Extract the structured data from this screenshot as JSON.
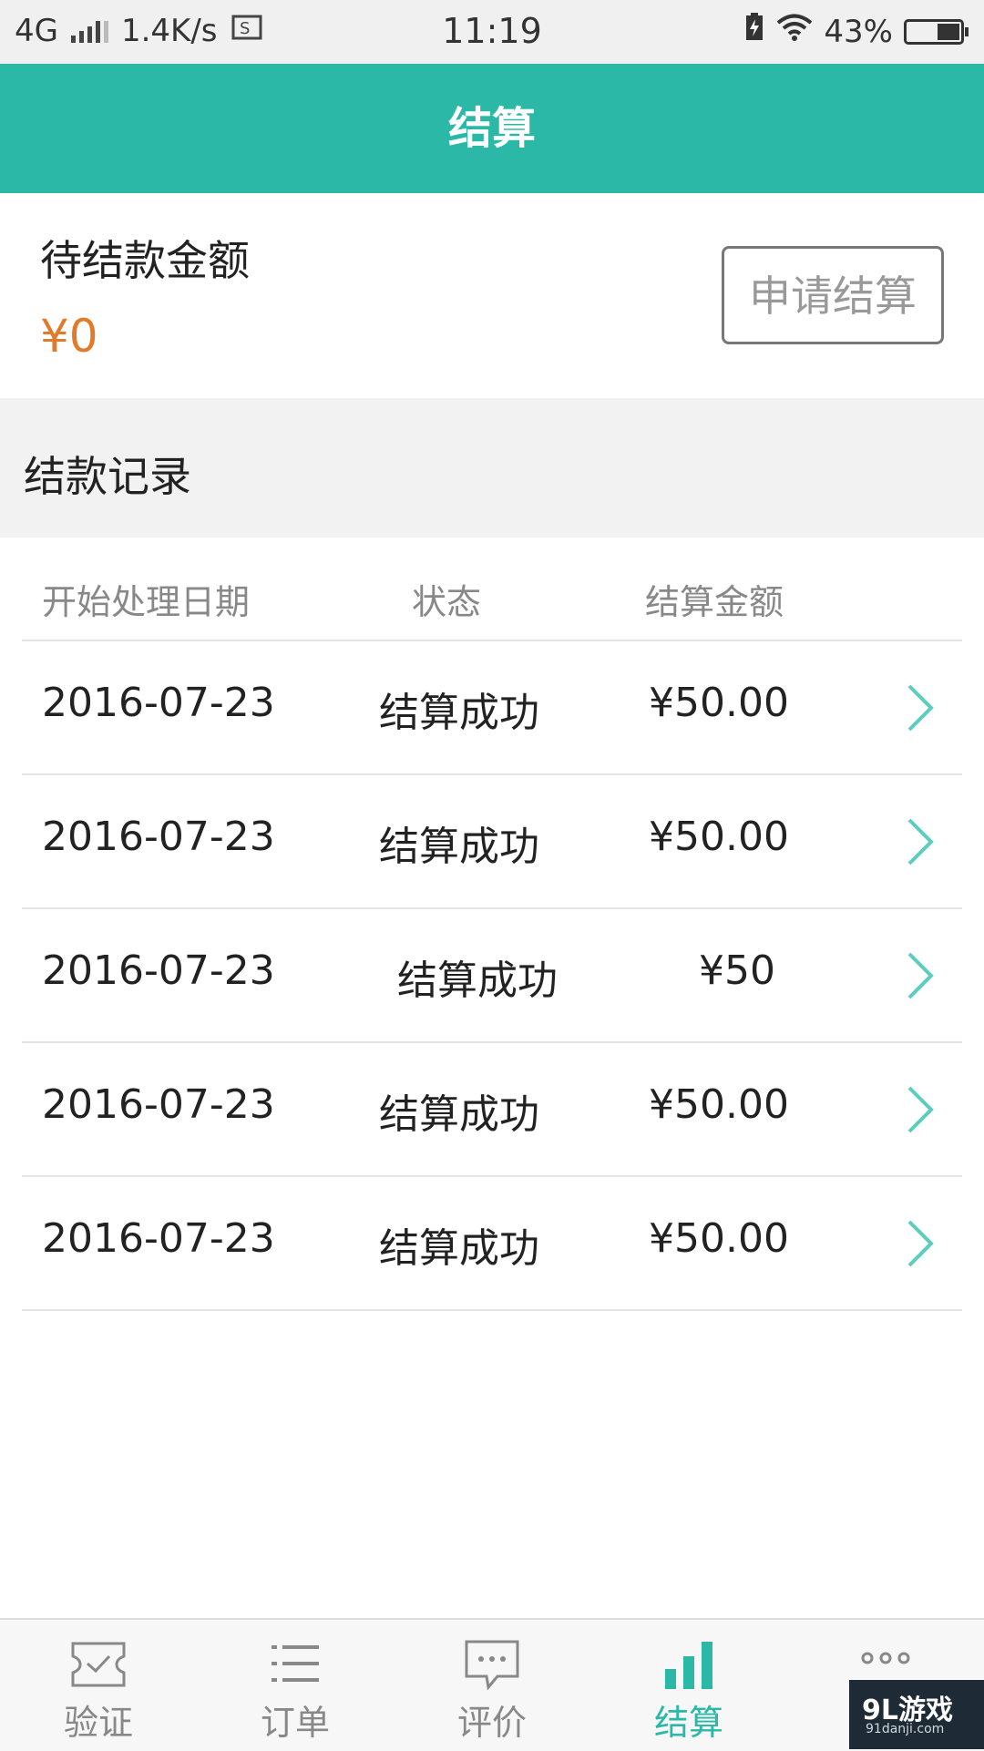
{
  "status_bar": {
    "network": "4G",
    "speed": "1.4K/s",
    "time": "11:19",
    "battery_percent": "43%",
    "battery_level": 0.43
  },
  "header": {
    "title": "结算"
  },
  "pending": {
    "label": "待结款金额",
    "amount": "¥0",
    "apply_button": "申请结算"
  },
  "records": {
    "title": "结款记录",
    "columns": [
      "开始处理日期",
      "状态",
      "结算金额"
    ],
    "rows": [
      {
        "date": "2016-07-23",
        "status": "结算成功",
        "amount": "¥50.00"
      },
      {
        "date": "2016-07-23",
        "status": "结算成功",
        "amount": "¥50.00"
      },
      {
        "date": "2016-07-23",
        "status": "结算成功",
        "amount": "¥50"
      },
      {
        "date": "2016-07-23",
        "status": "结算成功",
        "amount": "¥50.00"
      },
      {
        "date": "2016-07-23",
        "status": "结算成功",
        "amount": "¥50.00"
      }
    ]
  },
  "bottom_nav": [
    {
      "label": "验证",
      "icon": "ticket-icon"
    },
    {
      "label": "订单",
      "icon": "list-icon"
    },
    {
      "label": "评价",
      "icon": "chat-icon"
    },
    {
      "label": "结算",
      "icon": "bar-chart-icon",
      "active": true
    },
    {
      "label": "更多",
      "icon": "more-icon"
    }
  ],
  "colors": {
    "accent": "#2bb8a7",
    "amount": "#e27a2c"
  },
  "watermark": {
    "logo": "9L游戏",
    "url": "91danji.com"
  }
}
